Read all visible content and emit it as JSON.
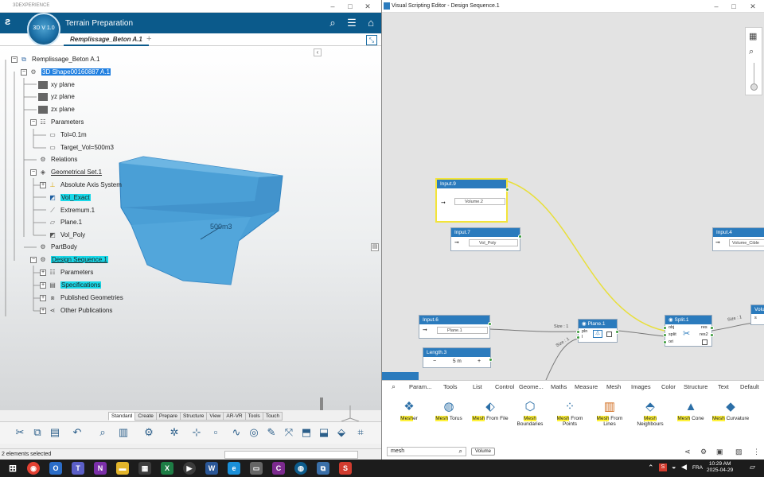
{
  "left_window": {
    "titlebar_text": "3DEXPERIENCE",
    "compass_label": "3D  V\n1.0",
    "app_title": "Terrain Preparation",
    "active_tab": "Remplissage_Beton A.1",
    "tab_add": "+",
    "tree": {
      "root": "Remplissage_Beton A.1",
      "shape": "3D Shape00160887 A.1",
      "xy": "xy plane",
      "yz": "yz plane",
      "zx": "zx plane",
      "parameters": "Parameters",
      "tol": "Tol=0.1m",
      "target_vol": "Target_Vol=500m3",
      "relations": "Relations",
      "geo_set": "Geometrical Set.1",
      "abs_axis": "Absolute Axis System",
      "vol_exact": "Vol_Exact",
      "extremum": "Extremum.1",
      "plane": "Plane.1",
      "vol_poly": "Vol_Poly",
      "partbody": "PartBody",
      "design_seq": "Design Sequence.1",
      "ds_params": "Parameters",
      "specs": "Specifications",
      "published": "Published Geometries",
      "other_pubs": "Other Publications"
    },
    "shape_annotation": "500m3",
    "bottom_tabs": [
      "Standard",
      "Create",
      "Prepare",
      "Structure",
      "View",
      "AR-VR",
      "Tools",
      "Touch"
    ],
    "active_bottom_tab": "Create",
    "status_text": "2 elements selected"
  },
  "right_window": {
    "title": "Visual Scripting Editor - Design Sequence.1",
    "nodes": {
      "input9": {
        "title": "Input.9",
        "field": "Volume.2"
      },
      "input7": {
        "title": "Input.7",
        "field": "Vol_Poly"
      },
      "input4": {
        "title": "Input.4",
        "field": "Volume_Cible"
      },
      "input6": {
        "title": "Input.6",
        "field": "Plane.1"
      },
      "length3": {
        "title": "Length.3",
        "minus": "−",
        "value": "5 m",
        "plus": "+"
      },
      "plane1": {
        "title": "Plane.1",
        "port_pln": "pln",
        "port_l": "l"
      },
      "split1": {
        "title": "Split.1",
        "in_obj": "obj",
        "in_split": "split",
        "in_ori": "ori",
        "out_res": "res",
        "out_res2": "res2"
      },
      "vol_partial": {
        "title": "Volu",
        "port": "s"
      }
    },
    "wire_labels": {
      "size1": "Size : 1",
      "size1b": "Size : 1",
      "size1c": "Size : 1"
    },
    "palette": {
      "tabs": [
        "Param...",
        "Tools",
        "List",
        "Control",
        "Geome...",
        "Maths",
        "Measure",
        "Mesh",
        "Images",
        "Color",
        "Structure",
        "Text",
        "Default"
      ],
      "items": [
        {
          "hl": "Mesh",
          "rest": "er",
          "line2": ""
        },
        {
          "hl": "Mesh",
          "rest": " Torus",
          "line2": ""
        },
        {
          "hl": "Mesh",
          "rest": " From File",
          "line2": ""
        },
        {
          "hl": "Mesh",
          "rest": "",
          "line2": "Boundaries"
        },
        {
          "hl": "Mesh",
          "rest": " From",
          "line2": "Points"
        },
        {
          "hl": "Mesh",
          "rest": " From",
          "line2": "Lines"
        },
        {
          "hl": "Mesh",
          "rest": "",
          "line2": "Neighbours"
        },
        {
          "hl": "Mesh",
          "rest": " Cone",
          "line2": ""
        },
        {
          "hl": "Mesh",
          "rest": " Curvature",
          "line2": ""
        }
      ],
      "search_value": "mesh",
      "chip": "Volume"
    }
  },
  "taskbar": {
    "lang": "FRA",
    "time": "10:29 AM",
    "date": "2025-04-29"
  }
}
